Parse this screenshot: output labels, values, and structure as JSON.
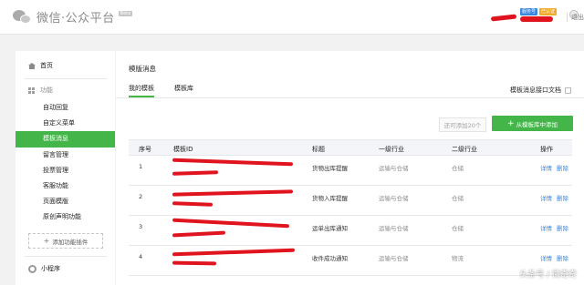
{
  "header": {
    "logo_text": "微信·公众平台",
    "beta_label": "Beta",
    "badge_blue": "服务号",
    "badge_orange": "已认证",
    "logout_label": "退出"
  },
  "sidebar": {
    "home_label": "首页",
    "group_label": "功能",
    "items": [
      {
        "label": "自动回复"
      },
      {
        "label": "自定义菜单"
      },
      {
        "label": "模板消息"
      },
      {
        "label": "留言管理"
      },
      {
        "label": "投票管理"
      },
      {
        "label": "客服功能"
      },
      {
        "label": "页面模版"
      },
      {
        "label": "原创声明功能"
      }
    ],
    "active_index": 2,
    "add_plugin_label": "添加功能插件",
    "mini_program_label": "小程序"
  },
  "main": {
    "page_title": "模版消息",
    "tabs": [
      {
        "label": "我的模板"
      },
      {
        "label": "模板库"
      }
    ],
    "doc_link_label": "模板消息接口文档",
    "quota_label": "还可添加20个",
    "add_button_label": "从模板库中添加",
    "table": {
      "headers": {
        "no": "序号",
        "id": "模板ID",
        "title": "标题",
        "ind1": "一级行业",
        "ind2": "二级行业",
        "op": "操作"
      },
      "rows": [
        {
          "no": "1",
          "title": "货物出库提醒",
          "ind1": "运输与仓储",
          "ind2": "仓储"
        },
        {
          "no": "2",
          "title": "货物入库提醒",
          "ind1": "运输与仓储",
          "ind2": "仓储"
        },
        {
          "no": "3",
          "title": "运单出库通知",
          "ind1": "运输与仓储",
          "ind2": "仓储"
        },
        {
          "no": "4",
          "title": "收件成功通知",
          "ind1": "运输与仓储",
          "ind2": "物流"
        }
      ],
      "op_detail": "详情",
      "op_delete": "删除"
    }
  },
  "watermark": "头条号 / 微奇奇"
}
